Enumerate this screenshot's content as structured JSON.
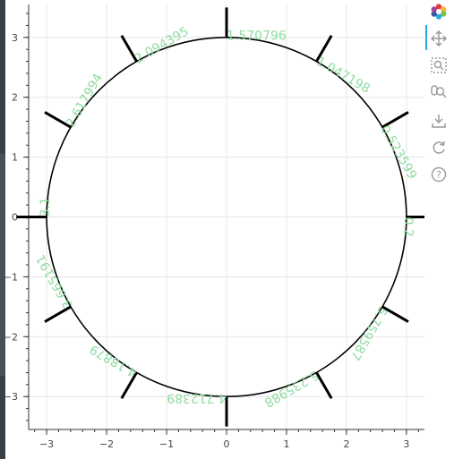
{
  "figure": {
    "xlim": [
      -3.3,
      3.3
    ],
    "ylim": [
      -3.55,
      3.55
    ],
    "x_ticks": [
      "−3",
      "−2",
      "−1",
      "0",
      "1",
      "2",
      "3"
    ],
    "x_tick_values": [
      -3,
      -2,
      -1,
      0,
      1,
      2,
      3
    ],
    "y_ticks": [
      "3",
      "2",
      "1",
      "0",
      "−1",
      "−2",
      "−3"
    ],
    "y_tick_values": [
      3,
      2,
      1,
      0,
      -1,
      -2,
      -3
    ],
    "grid": true,
    "circle_radius": 3,
    "tick_inner_radius": 3,
    "tick_outer_radius": 3.5,
    "label_color": "#8fdca0",
    "angles": [
      {
        "angle": 0,
        "label": "0.2"
      },
      {
        "angle": 0.523599,
        "label": "0.523599"
      },
      {
        "angle": 1.047198,
        "label": "1.047198"
      },
      {
        "angle": 1.570796,
        "label": "1.570796"
      },
      {
        "angle": 2.094395,
        "label": "2.094395"
      },
      {
        "angle": 2.617994,
        "label": "2.617994"
      },
      {
        "angle": 3.141593,
        "label": "3.1"
      },
      {
        "angle": 3.665191,
        "label": "3.665191"
      },
      {
        "angle": 4.18879,
        "label": "4.18879"
      },
      {
        "angle": 4.712389,
        "label": "4.712389"
      },
      {
        "angle": 5.235988,
        "label": "5.235988"
      },
      {
        "angle": 5.759587,
        "label": "5.759587"
      }
    ]
  },
  "toolbar": {
    "items": [
      {
        "name": "bokeh-logo",
        "icon": "bokeh-logo-icon"
      },
      {
        "name": "pan-tool",
        "icon": "pan-icon"
      },
      {
        "name": "box-zoom-tool",
        "icon": "box-zoom-icon"
      },
      {
        "name": "wheel-zoom-tool",
        "icon": "wheel-zoom-icon"
      },
      {
        "name": "save-tool",
        "icon": "save-icon"
      },
      {
        "name": "reset-tool",
        "icon": "reset-icon"
      },
      {
        "name": "help-tool",
        "icon": "help-icon"
      }
    ],
    "accent": "#26aae1"
  }
}
